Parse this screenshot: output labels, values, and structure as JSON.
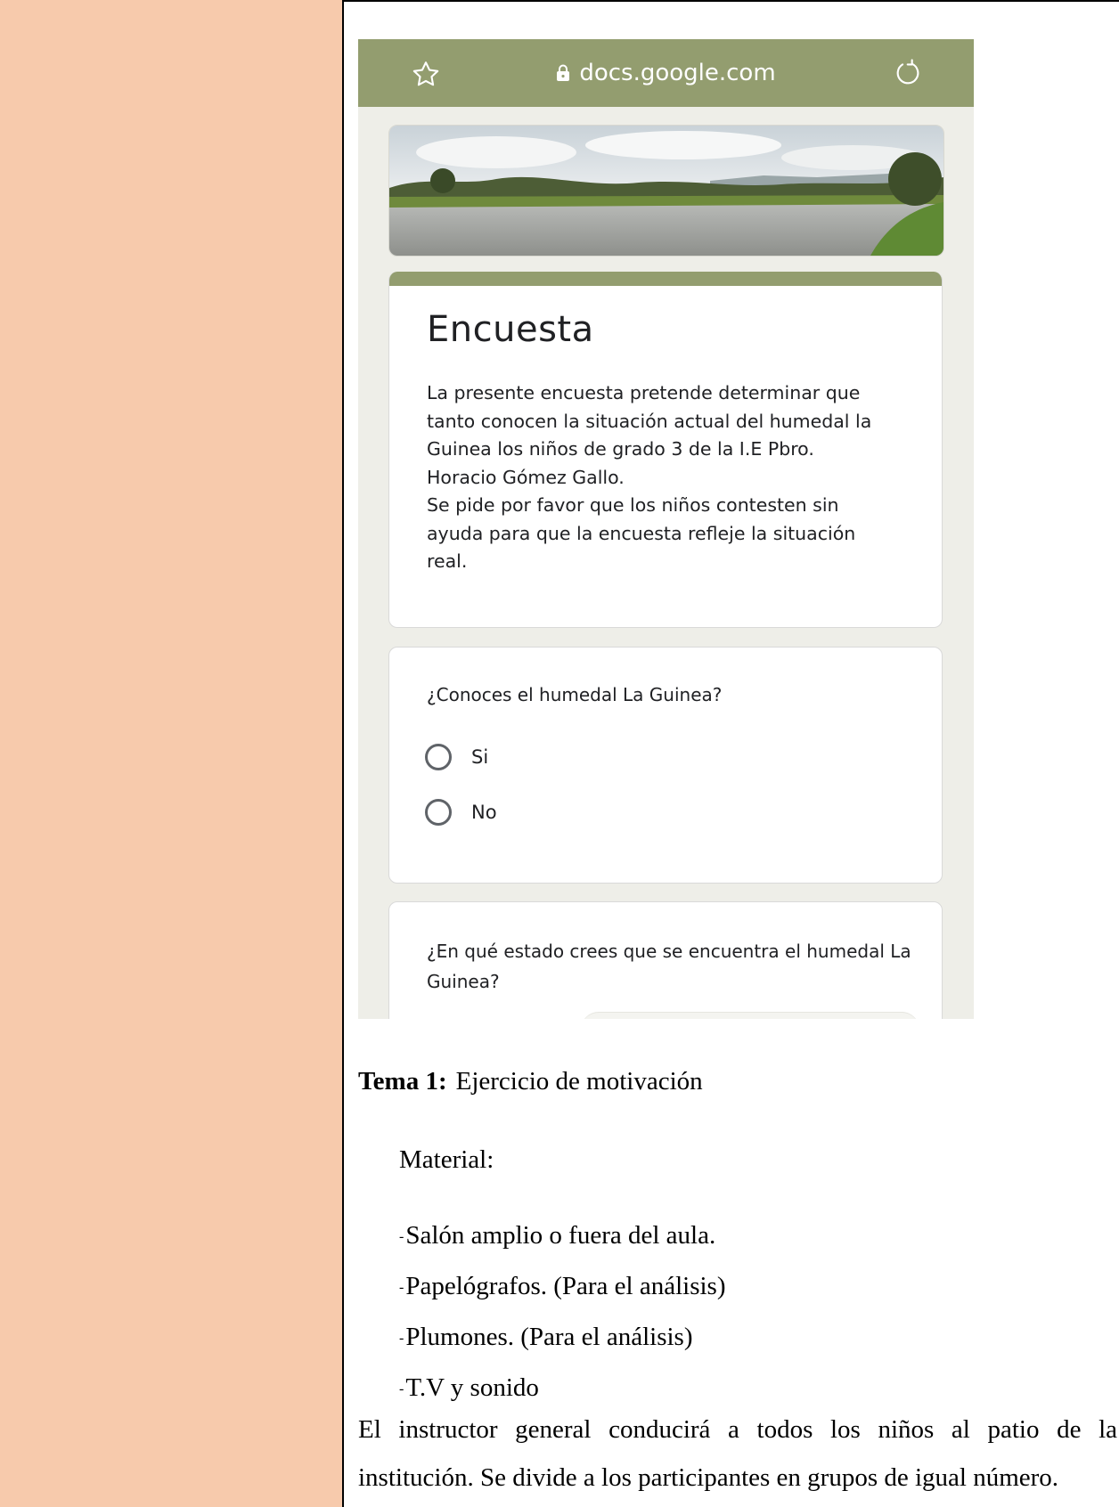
{
  "browser": {
    "url": "docs.google.com"
  },
  "form": {
    "title": "Encuesta",
    "description": "La presente encuesta pretende  determinar que\ntanto conocen la situación actual del humedal la\nGuinea los niños de grado 3 de la I.E Pbro.\nHoracio Gómez Gallo.\nSe pide por favor que los niños contesten sin\nayuda para que la encuesta refleje la situación\nreal.",
    "q1": {
      "question": "¿Conoces el humedal La Guinea?",
      "options": [
        "Si",
        "No"
      ]
    },
    "q2": {
      "question_line1": "¿En qué estado crees que se encuentra el humedal La",
      "question_line2": "Guinea?"
    }
  },
  "doc": {
    "tema_label": "Tema 1:",
    "tema_title": "Ejercicio de motivación",
    "material_label": "Material:",
    "materials": [
      "Salón amplio o fuera del aula.",
      "Papelógrafos. (Para el análisis)",
      "Plumones. (Para el análisis)",
      "T.V y sonido"
    ],
    "paragraph": "El instructor general conducirá a todos los niños al patio de la institución. Se divide a los participantes en grupos de igual número."
  },
  "colors": {
    "left_column": "#f7caac",
    "form_accent": "#939d6f",
    "form_background": "#eeeee8"
  }
}
